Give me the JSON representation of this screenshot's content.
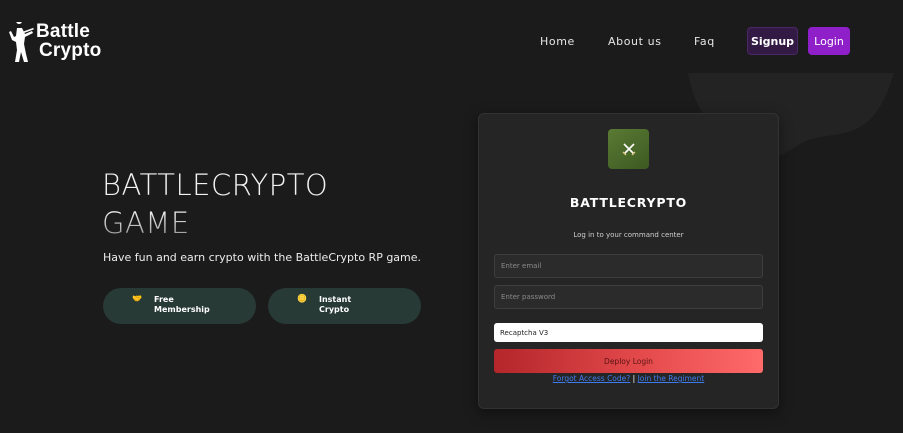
{
  "header": {
    "logo": {
      "line1": "Battle",
      "line2": "Crypto"
    },
    "nav": [
      {
        "label": "Home"
      },
      {
        "label": "About us"
      },
      {
        "label": "Faq"
      }
    ],
    "signup_label": "Signup",
    "login_label": "Login"
  },
  "hero": {
    "title_line1": "BATTLECRYPTO",
    "title_line2": "GAME",
    "subtitle": "Have fun and earn crypto with the BattleCrypto RP game.",
    "pills": [
      {
        "icon": "handshake-icon",
        "line1": "Free",
        "line2": "Membership"
      },
      {
        "icon": "coins-icon",
        "line1": "Instant",
        "line2": "Crypto"
      }
    ]
  },
  "login_card": {
    "title": "BATTLECRYPTO",
    "subtitle": "Log in to your command center",
    "email_placeholder": "Enter email",
    "password_placeholder": "Enter password",
    "captcha_label": "Recaptcha V3",
    "submit_label": "Deploy Login",
    "forgot_link": "Forgot Access Code?",
    "separator": "|",
    "join_link": "Join the Regiment"
  },
  "colors": {
    "background": "#1b1b1c",
    "signup_bg": "#331a44",
    "login_bg": "#8e1fc9",
    "pill_bg": "#283a35",
    "submit_gradient_start": "#b3262a",
    "submit_gradient_end": "#ff6a6a",
    "link": "#3e7df0"
  }
}
